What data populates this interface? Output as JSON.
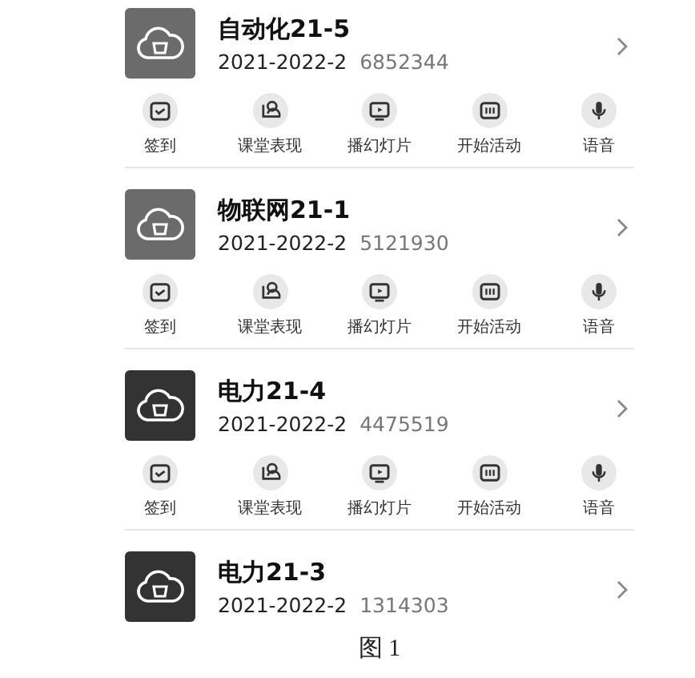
{
  "courses": [
    {
      "name": "自动化21-5",
      "term": "2021-2022-2",
      "code": "6852344",
      "color": "#6b6b6b",
      "actions": [
        {
          "kind": "checkin",
          "label": "签到"
        },
        {
          "kind": "performance",
          "label": "课堂表现"
        },
        {
          "kind": "slides",
          "label": "播幻灯片"
        },
        {
          "kind": "activity",
          "label": "开始活动"
        },
        {
          "kind": "voice",
          "label": "语音"
        }
      ]
    },
    {
      "name": "物联网21-1",
      "term": "2021-2022-2",
      "code": "5121930",
      "color": "#6b6b6b",
      "actions": [
        {
          "kind": "checkin",
          "label": "签到"
        },
        {
          "kind": "performance",
          "label": "课堂表现"
        },
        {
          "kind": "slides",
          "label": "播幻灯片"
        },
        {
          "kind": "activity",
          "label": "开始活动"
        },
        {
          "kind": "voice",
          "label": "语音"
        }
      ]
    },
    {
      "name": "电力21-4",
      "term": "2021-2022-2",
      "code": "4475519",
      "color": "#333333",
      "actions": [
        {
          "kind": "checkin",
          "label": "签到"
        },
        {
          "kind": "performance",
          "label": "课堂表现"
        },
        {
          "kind": "slides",
          "label": "播幻灯片"
        },
        {
          "kind": "activity",
          "label": "开始活动"
        },
        {
          "kind": "voice",
          "label": "语音"
        }
      ]
    },
    {
      "name": "电力21-3",
      "term": "2021-2022-2",
      "code": "1314303",
      "color": "#333333"
    }
  ],
  "caption": "图 1"
}
